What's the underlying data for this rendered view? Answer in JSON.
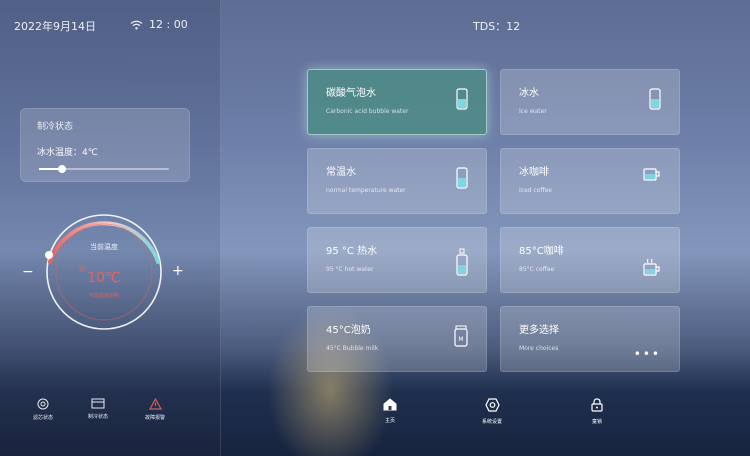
{
  "header": {
    "date": "2022年9月14日",
    "time": "12 : 00",
    "tds": "TDS：12"
  },
  "status_card": {
    "title": "制冷状态",
    "ice_temp_label": "冰水温度：4℃",
    "slider_level": 0.18
  },
  "dial": {
    "label": "当前温度",
    "value": "10℃",
    "sub": "当前温度说明",
    "minus_label": "−",
    "plus_label": "+"
  },
  "left_footer": [
    {
      "label": "滤芯状态",
      "icon": "filter-icon"
    },
    {
      "label": "制冷状态",
      "icon": "cooling-icon"
    },
    {
      "label": "故障报警",
      "icon": "warning-icon"
    }
  ],
  "cards": [
    {
      "title": "碳酸气泡水",
      "sub": "Carbonic acid bubble water",
      "icon": "cup-icon",
      "active": true
    },
    {
      "title": "冰水",
      "sub": "Ice water",
      "icon": "cup-icon",
      "active": false
    },
    {
      "title": "常温水",
      "sub": "normal temperature water",
      "icon": "cup-icon",
      "active": false
    },
    {
      "title": "冰咖啡",
      "sub": "Iced coffee",
      "icon": "mug-icon",
      "active": false
    },
    {
      "title": "95 °C 热水",
      "sub": "95 °C hot water",
      "icon": "bottle-icon",
      "active": false
    },
    {
      "title": "85°C咖啡",
      "sub": "85°C coffee",
      "icon": "mug-icon",
      "active": false
    },
    {
      "title": "45°C泡奶",
      "sub": "45°C Bubble milk",
      "icon": "milk-icon",
      "active": false
    },
    {
      "title": "更多选择",
      "sub": "More choices",
      "icon": "more-icon",
      "active": false
    }
  ],
  "bottom_nav": [
    {
      "label": "主页",
      "icon": "home-icon"
    },
    {
      "label": "系统设置",
      "icon": "settings-icon"
    },
    {
      "label": "童锁",
      "icon": "lock-icon"
    }
  ],
  "colors": {
    "accent_red": "#e7635c",
    "accent_teal": "#7fd6e0",
    "active_card": "#4e8c87"
  }
}
